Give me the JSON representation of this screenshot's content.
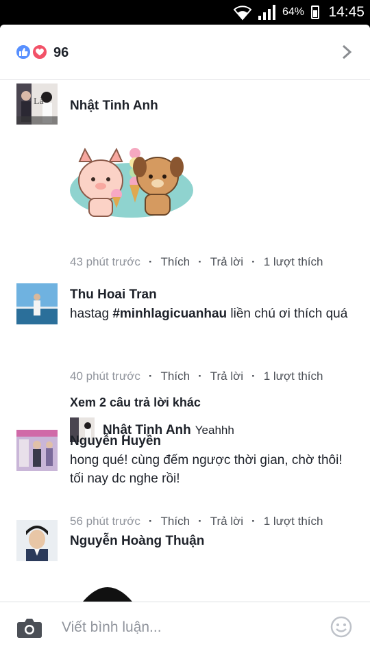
{
  "status_bar": {
    "battery_percent": "64%",
    "time": "14:45"
  },
  "reactions": {
    "count": "96",
    "types": [
      "like-icon",
      "love-icon"
    ]
  },
  "comments": [
    {
      "author": "Nhật Tinh Anh",
      "attachment": "sticker-pig-dog-icecream",
      "meta": {
        "time": "43 phút trước",
        "like": "Thích",
        "reply": "Trả lời",
        "likes": "1 lượt thích"
      }
    },
    {
      "author": "Thu Hoai Tran",
      "text_prefix": "hastag ",
      "hashtag": "#minhlagicuanhau",
      "text_suffix": " liền chú ơi thích quá",
      "meta": {
        "time": "40 phút trước",
        "like": "Thích",
        "reply": "Trả lời",
        "likes": "1 lượt thích"
      },
      "more_replies": "Xem 2 câu trả lời khác",
      "reply": {
        "author": "Nhật Tinh Anh",
        "text": "Yeahhh"
      }
    },
    {
      "author": "Nguyễn Huyền",
      "text": "hong qué! cùng đếm ngược thời gian, chờ thôi! tối nay dc nghe rồi!",
      "meta": {
        "time": "56 phút trước",
        "like": "Thích",
        "reply": "Trả lời",
        "likes": "1 lượt thích"
      }
    },
    {
      "author": "Nguyễn Hoàng Thuận"
    }
  ],
  "composer": {
    "placeholder": "Viết bình luận..."
  },
  "colors": {
    "like_blue": "#5890ff",
    "love_red": "#f25268",
    "text_dark": "#1d2129",
    "meta_gray": "#90949c"
  }
}
